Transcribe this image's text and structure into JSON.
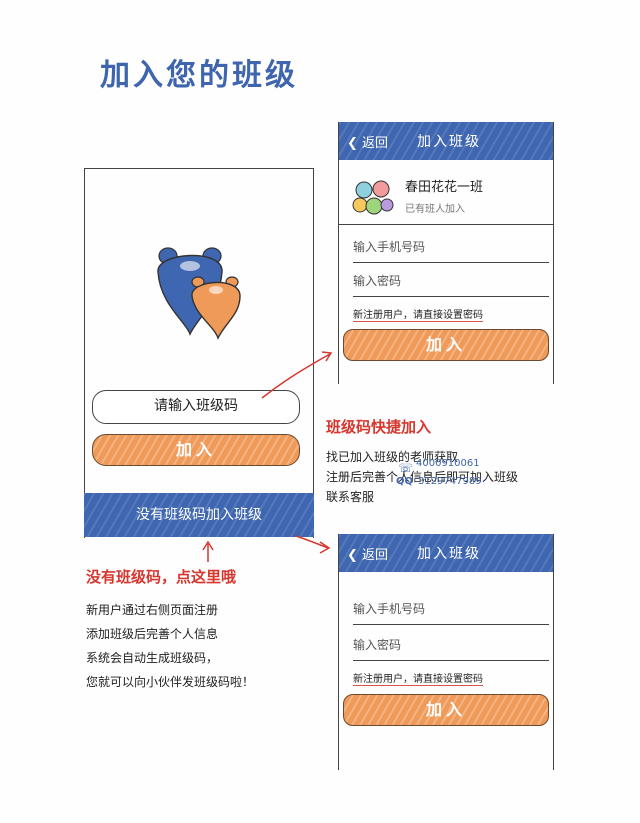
{
  "title": "加入您的班级",
  "main_screen": {
    "code_placeholder": "请输入班级码",
    "join_label": "加入",
    "no_code_label": "没有班级码加入班级"
  },
  "right_screen_top": {
    "back_label": "返回",
    "header_title": "加入班级",
    "class_name": "春田花花一班",
    "class_subtitle": "已有班人加入",
    "phone_placeholder": "输入手机号码",
    "password_placeholder": "输入密码",
    "new_user_hint": "新注册用户，请直接设置密码",
    "join_label": "加入"
  },
  "right_screen_bottom": {
    "back_label": "返回",
    "header_title": "加入班级",
    "phone_placeholder": "输入手机号码",
    "password_placeholder": "输入密码",
    "new_user_hint": "新注册用户，请直接设置密码",
    "join_label": "加入"
  },
  "annotation_fast_join": {
    "heading": "班级码快捷加入",
    "lines": [
      "找已加入班级的老师获取",
      "注册后完善个人信息后即可加入班级",
      "联系客服"
    ],
    "phone": "4000910061",
    "qq_label": "QQ",
    "qq": "3129747989"
  },
  "annotation_no_code": {
    "heading": "没有班级码，点这里哦",
    "lines": [
      "新用户通过右侧页面注册",
      "添加班级后完善个人信息",
      "系统会自动生成班级码，",
      "您就可以向小伙伴发班级码啦！"
    ]
  },
  "colors": {
    "brand_blue": "#3f66b0",
    "accent_orange": "#ef9a58",
    "annotation_red": "#d6372f"
  }
}
